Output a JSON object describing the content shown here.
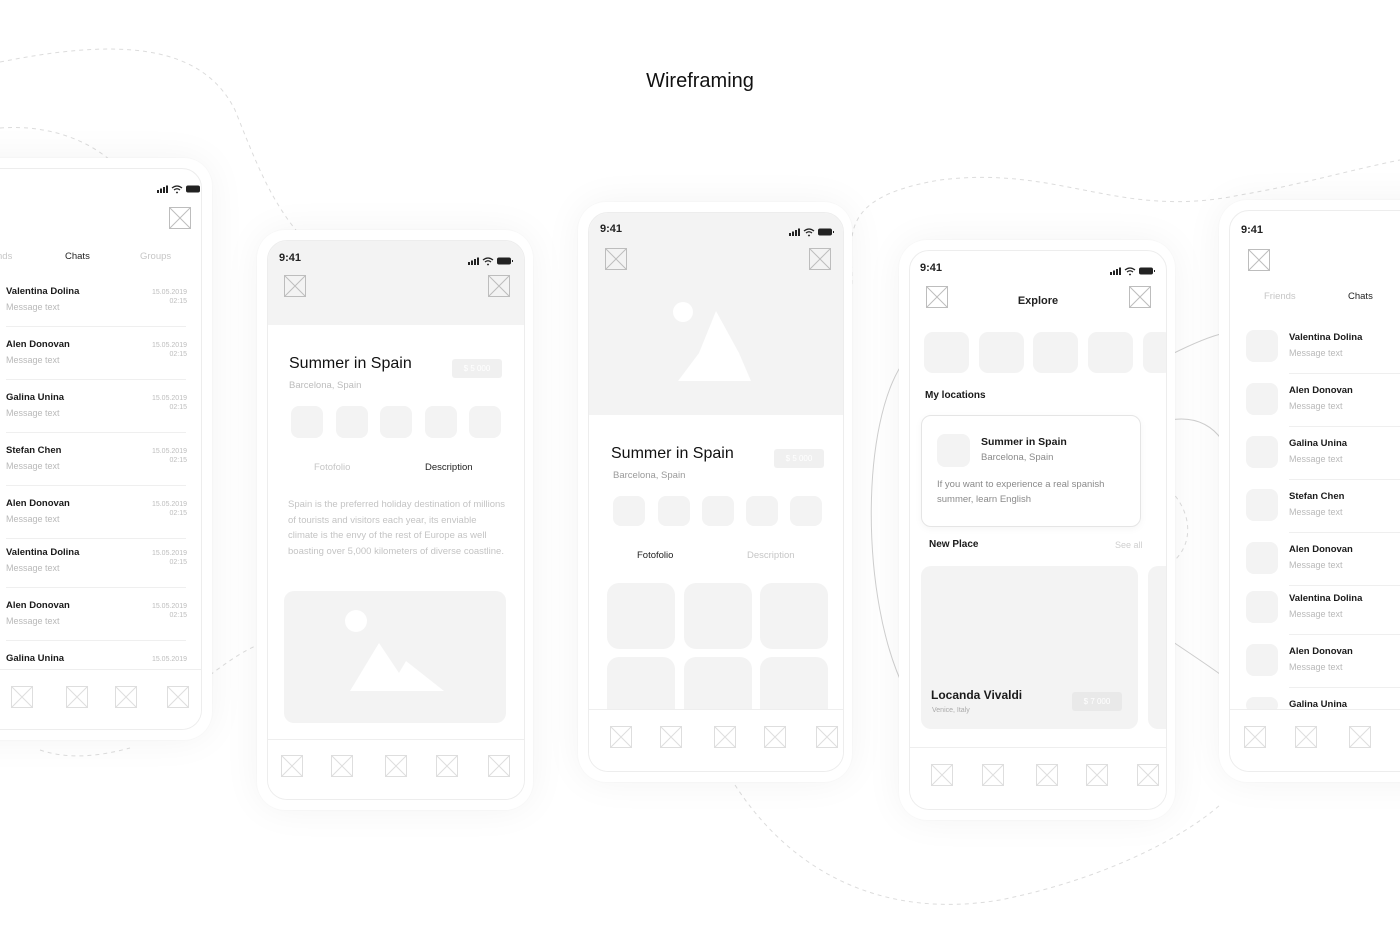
{
  "page": {
    "title": "Wireframing"
  },
  "status_time": "9:41",
  "chat_list_left": {
    "tabs": [
      "nds",
      "Chats",
      "Groups"
    ],
    "active_tab": 1,
    "chats": [
      {
        "name": "Valentina Dolina",
        "message": "Message text",
        "date": "15.05.2019",
        "time": "02:15"
      },
      {
        "name": "Alen Donovan",
        "message": "Message text",
        "date": "15.05.2019",
        "time": "02:15"
      },
      {
        "name": "Galina Unina",
        "message": "Message text",
        "date": "15.05.2019",
        "time": "02:15"
      },
      {
        "name": "Stefan Chen",
        "message": "Message text",
        "date": "15.05.2019",
        "time": "02:15"
      },
      {
        "name": "Alen Donovan",
        "message": "Message text",
        "date": "15.05.2019",
        "time": "02:15"
      },
      {
        "name": "Valentina Dolina",
        "message": "Message text",
        "date": "15.05.2019",
        "time": "02:15"
      },
      {
        "name": "Alen Donovan",
        "message": "Message text",
        "date": "15.05.2019",
        "time": "02:15"
      },
      {
        "name": "Galina Unina",
        "message": "",
        "date": "15.05.2019",
        "time": ""
      }
    ]
  },
  "detail_description": {
    "title": "Summer in Spain",
    "location": "Barcelona, Spain",
    "price": "$ 5 000",
    "tabs": [
      "Fotofolio",
      "Description"
    ],
    "active_tab": 1,
    "description": "Spain is the preferred holiday destination of millions of tourists and visitors each year, its enviable climate is the envy of the rest of Europe as well boasting over 5,000 kilometers of diverse coastline."
  },
  "detail_fotofolio": {
    "title": "Summer in Spain",
    "location": "Barcelona, Spain",
    "price": "$ 5 000",
    "tabs": [
      "Fotofolio",
      "Description"
    ],
    "active_tab": 0
  },
  "explore": {
    "header": "Explore",
    "section_my_locations": "My locations",
    "card": {
      "title": "Summer in Spain",
      "subtitle": "Barcelona, Spain",
      "text": "If you want to experience a real spanish summer, learn English"
    },
    "section_new_place": "New Place",
    "see_all": "See all",
    "place": {
      "name": "Locanda Vivaldi",
      "location": "Venice, Italy",
      "price": "$ 7 000"
    }
  },
  "chat_list_right": {
    "tabs": [
      "Friends",
      "Chats"
    ],
    "active_tab": 1,
    "chats": [
      {
        "name": "Valentina Dolina",
        "message": "Message text"
      },
      {
        "name": "Alen Donovan",
        "message": "Message text"
      },
      {
        "name": "Galina Unina",
        "message": "Message text"
      },
      {
        "name": "Stefan Chen",
        "message": "Message text"
      },
      {
        "name": "Alen Donovan",
        "message": "Message text"
      },
      {
        "name": "Valentina Dolina",
        "message": "Message text"
      },
      {
        "name": "Alen Donovan",
        "message": "Message text"
      },
      {
        "name": "Galina Unina",
        "message": ""
      }
    ]
  }
}
